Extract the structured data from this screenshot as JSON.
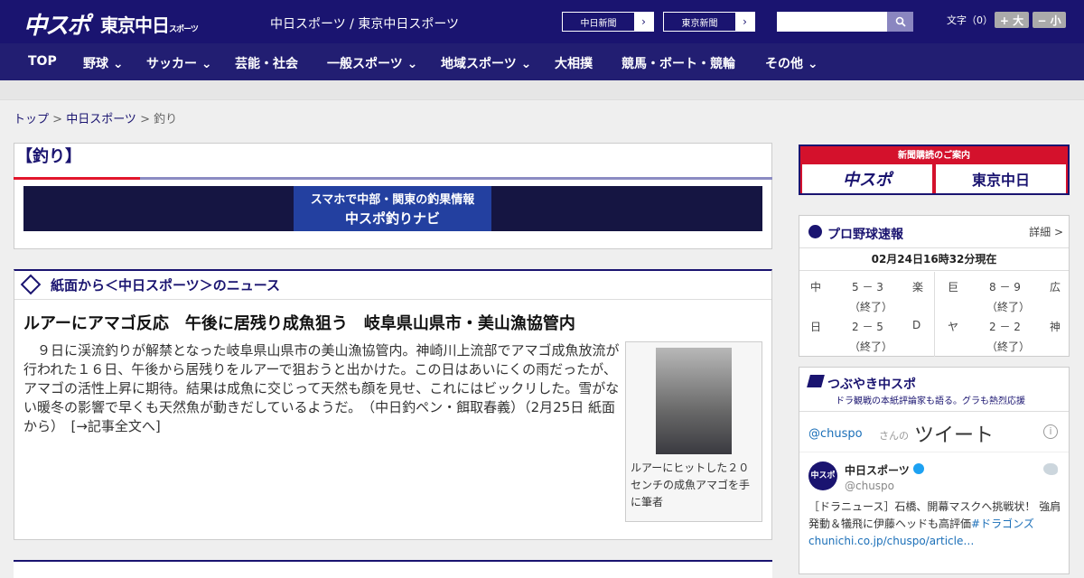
{
  "header": {
    "logo_chunichi": "中スポ",
    "logo_tokyo": "東京中日",
    "logo_tokyo_small": "スポーツ",
    "site_title": "中日スポーツ / 東京中日スポーツ",
    "chunichi_shimbun": "中日新聞",
    "tokyo_shimbun": "東京新聞",
    "search_placeholder": "",
    "font_size_label": "文字（0）",
    "font_larger": "+ 大",
    "font_smaller": "− 小"
  },
  "nav": [
    "TOP",
    "野球",
    "サッカー",
    "芸能・社会",
    "一般スポーツ",
    "地域スポーツ",
    "大相撲",
    "競馬・ボート・競輪",
    "その他"
  ],
  "breadcrumb": {
    "home": "トップ",
    "section": "中日スポーツ",
    "current": "釣り"
  },
  "section_title": "【釣り】",
  "banner_text": "スマホで中部・関東の釣果情報",
  "banner_sub": "中スポ釣りナビ",
  "news": {
    "heading": "紙面から＜中日スポーツ＞のニュース",
    "title": "ルアーにアマゴ反応　午後に居残り成魚狙う　岐阜県山県市・美山漁協管内",
    "body": "　９日に渓流釣りが解禁となった岐阜県山県市の美山漁協管内。神崎川上流部でアマゴ成魚放流が行われた１６日、午後から居残りをルアーで狙おうと出かけた。この日はあいにくの雨だったが、アマゴの活性上昇に期待。結果は成魚に交じって天然も顔を見せ、これにはビックリした。雪がない暖冬の影響で早くも天然魚が動きだしているようだ。　（中日釣ペン・餌取春義）（2月25日 紙面から）　[→記事全文へ]",
    "photo_caption": "ルアーにヒットした２０センチの成魚アマゴを手に筆者"
  },
  "sidebar": {
    "subscribe": "新聞購読のご案内",
    "sub_logo1": "中スポ",
    "sub_logo2": "東京中日",
    "baseball_title": "プロ野球速報",
    "details": "詳細 >",
    "timestamp": "02月24日16時32分現在",
    "games": [
      {
        "home": "中",
        "score": "5 － 3",
        "away": "楽",
        "status": "（終了）"
      },
      {
        "home": "巨",
        "score": "8 － 9",
        "away": "広",
        "status": "（終了）"
      },
      {
        "home": "日",
        "score": "2 － 5",
        "away": "D",
        "status": "（終了）"
      },
      {
        "home": "ヤ",
        "score": "2 － 2",
        "away": "神",
        "status": "（終了）"
      }
    ],
    "tweet_title": "つぶやき中スポ",
    "tweet_sub": "ドラ観戦の本紙評論家も語る。グラも熱烈応援",
    "tweet_user": "@chuspo",
    "tweet_user_suffix": "さんの",
    "tweet_word": "ツイート",
    "account_name": "中日スポーツ",
    "account_handle": "@chuspo",
    "tweet_text": "［ドラニュース］石橋、開幕マスクへ挑戦状！ 強肩発動＆犠飛に伊藤ヘッドも高評価",
    "tweet_tag": "#ドラゴンズ",
    "tweet_link": "chunichi.co.jp/chuspo/article…"
  }
}
